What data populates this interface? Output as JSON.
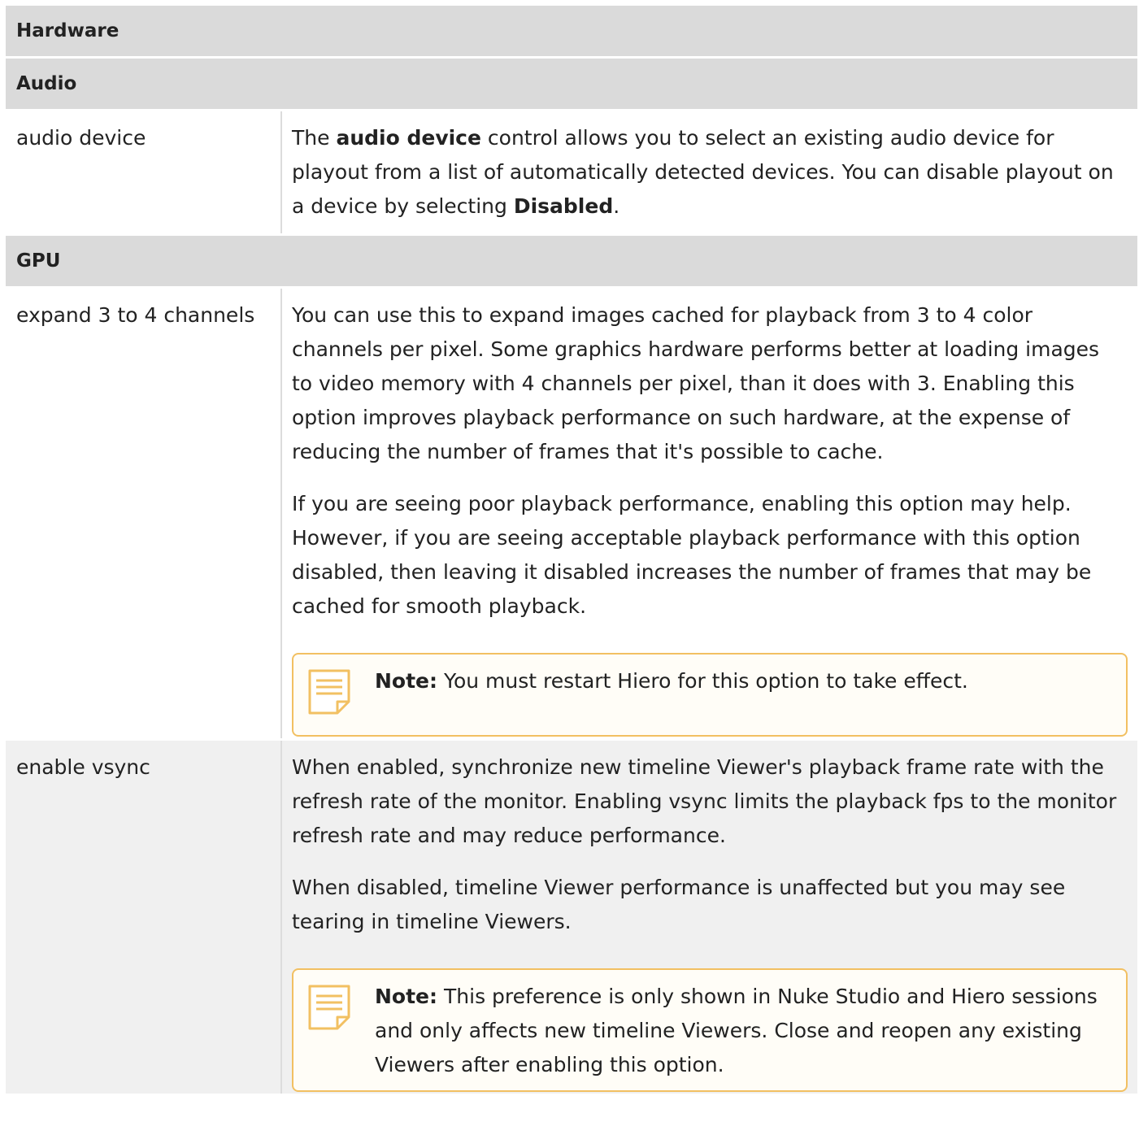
{
  "sections": {
    "hardware": "Hardware",
    "audio": "Audio",
    "gpu": "GPU"
  },
  "audio_device": {
    "label": "audio device",
    "desc_1": "The ",
    "desc_bold_1": "audio device",
    "desc_2": " control allows you to select an existing audio device for playout from a list of automatically detected devices. You can disable playout on a device by selecting ",
    "desc_bold_2": "Disabled",
    "desc_3": "."
  },
  "expand_channels": {
    "label": "expand 3 to 4 channels",
    "para_1": "You can use this to expand images cached for playback from 3 to 4 color channels per pixel. Some graphics hardware performs better at loading images to video memory with 4 channels per pixel, than it does with 3. Enabling this option improves playback performance on such hardware, at the expense of reducing the number of frames that it's possible to cache.",
    "para_2": "If you are seeing poor playback performance, enabling this option may help. However, if you are seeing acceptable playback performance with this option disabled, then leaving it disabled increases the number of frames that may be cached for smooth playback.",
    "note_label": "Note:",
    "note_text": "You must restart Hiero for this option to take effect."
  },
  "enable_vsync": {
    "label": "enable vsync",
    "para_1": "When enabled, synchronize new timeline Viewer's playback frame rate with the refresh rate of the monitor. Enabling vsync limits the playback fps to the monitor refresh rate and may reduce performance.",
    "para_2": "When disabled, timeline Viewer performance is unaffected but you may see tearing in timeline Viewers.",
    "note_label": "Note:",
    "note_text": "This preference is only shown in Nuke Studio and Hiero sessions and only affects new timeline Viewers. Close and reopen any existing Viewers after enabling this option."
  },
  "colors": {
    "header_bg": "#dadada",
    "alt_row_bg": "#f0f0f0",
    "note_border": "#f2c062"
  },
  "icons": {
    "note": "note-icon"
  }
}
